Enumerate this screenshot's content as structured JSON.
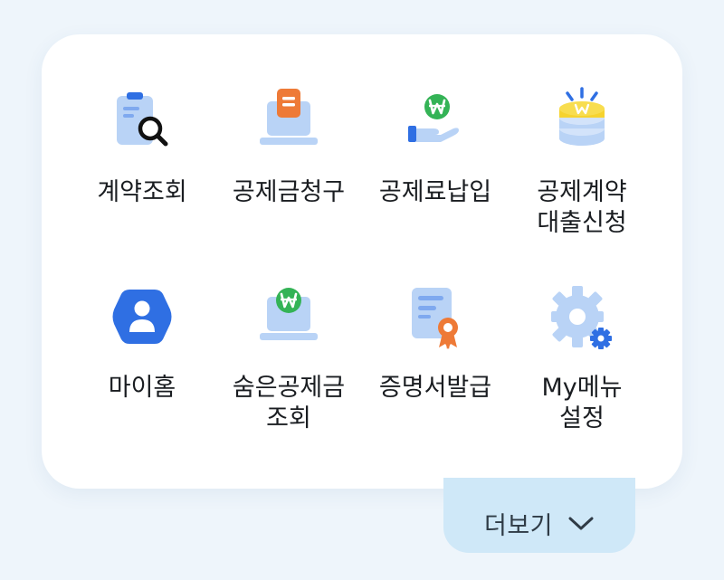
{
  "menu": {
    "items": [
      {
        "label_lines": [
          "계약조회"
        ],
        "icon": "contract-search-icon"
      },
      {
        "label_lines": [
          "공제금청구"
        ],
        "icon": "claim-laptop-icon"
      },
      {
        "label_lines": [
          "공제료납입"
        ],
        "icon": "hand-won-coin-icon"
      },
      {
        "label_lines": [
          "공제계약",
          "대출신청"
        ],
        "icon": "won-coin-stack-icon"
      },
      {
        "label_lines": [
          "마이홈"
        ],
        "icon": "user-profile-icon"
      },
      {
        "label_lines": [
          "숨은공제금",
          "조회"
        ],
        "icon": "won-laptop-icon"
      },
      {
        "label_lines": [
          "증명서발급"
        ],
        "icon": "certificate-badge-icon"
      },
      {
        "label_lines": [
          "My메뉴",
          "설정"
        ],
        "icon": "gear-settings-icon"
      }
    ]
  },
  "more_button": {
    "label": "더보기",
    "icon": "chevron-down-icon"
  },
  "colors": {
    "background": "#eef5fb",
    "card": "#ffffff",
    "more_button_bg": "#cfe8f8",
    "primary_blue": "#2f6fe3",
    "light_blue": "#b9d3f6",
    "green": "#34b356",
    "orange": "#ee7a37",
    "yellow": "#f6d32f"
  }
}
